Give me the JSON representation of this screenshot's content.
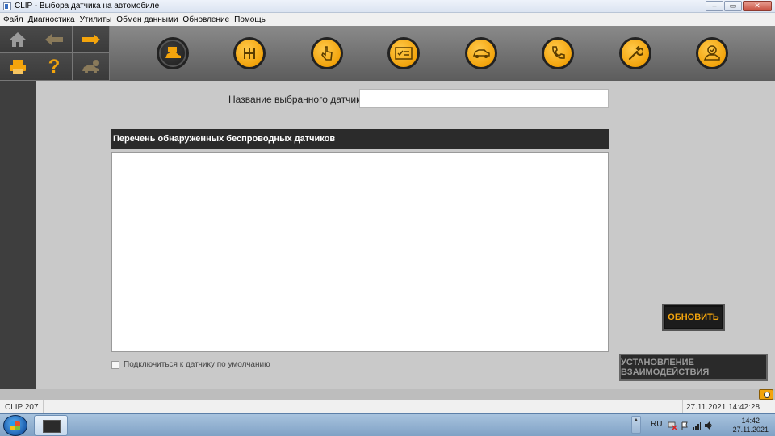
{
  "window": {
    "title": "CLIP - Выбора датчика на автомобиле",
    "minimize": "–",
    "maximize": "▭",
    "close": "✕"
  },
  "menu": [
    "Файл",
    "Диагностика",
    "Утилиты",
    "Обмен данными",
    "Обновление",
    "Помощь"
  ],
  "toolbar": {
    "nav_icons": [
      "home-icon",
      "back-arrow-icon",
      "forward-arrow-icon",
      "print-icon",
      "help-icon",
      "vehicle-alert-icon"
    ],
    "help_glyph": "?",
    "tool_icons": [
      "sensor-vehicle-icon",
      "gearbox-icon",
      "touch-icon",
      "checklist-icon",
      "car-top-icon",
      "phone-icon",
      "wrench-icon",
      "vehicle-check-icon"
    ],
    "active_tool": 0,
    "accent_color": "#f3a40c"
  },
  "main": {
    "sensor_name_label": "Название выбранного датчика",
    "sensor_name_value": "",
    "list_title": "Перечень обнаруженных беспроводных датчиков",
    "list_items": [],
    "default_connect_label": "Подключиться к датчику по умолчанию",
    "default_connect_checked": false,
    "refresh_button": "ОБНОВИТЬ",
    "connect_button": "УСТАНОВЛЕНИЕ ВЗАИМОДЕЙСТВИЯ"
  },
  "statusbar": {
    "left": "CLIP 207",
    "right": "27.11.2021 14:42:28"
  },
  "taskbar": {
    "language": "RU",
    "tray_arrow": "▲",
    "time": "14:42",
    "date": "27.11.2021"
  }
}
